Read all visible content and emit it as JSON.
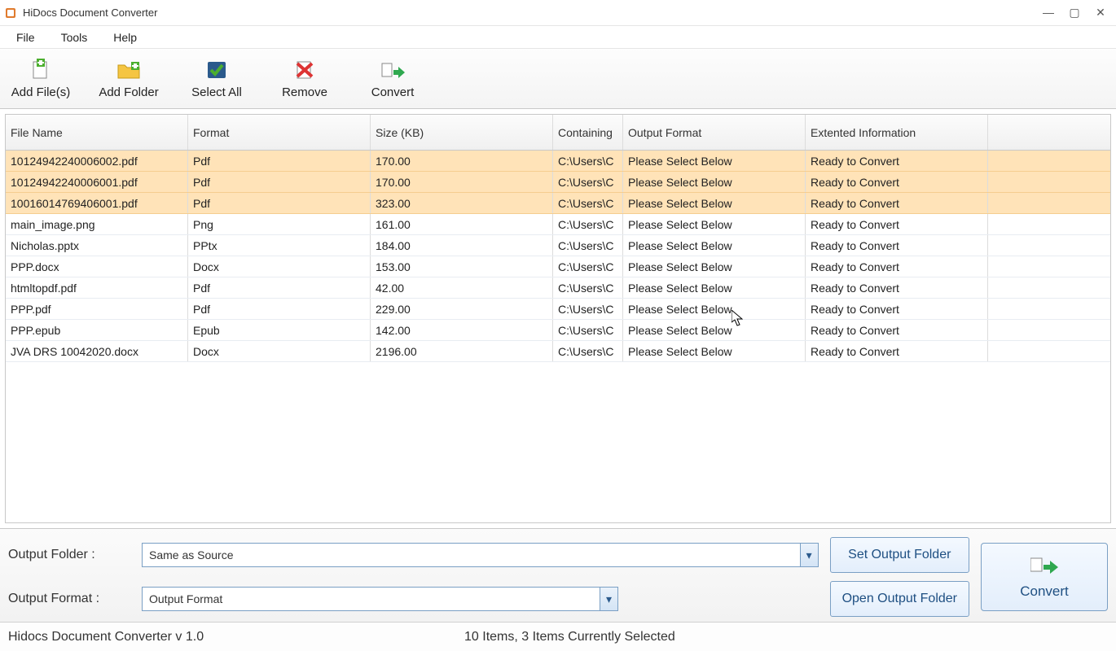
{
  "window": {
    "title": "HiDocs Document Converter"
  },
  "menu": {
    "items": [
      "File",
      "Tools",
      "Help"
    ]
  },
  "toolbar": {
    "add_files": "Add File(s)",
    "add_folder": "Add Folder",
    "select_all": "Select All",
    "remove": "Remove",
    "convert": "Convert"
  },
  "table": {
    "headers": {
      "filename": "File Name",
      "format": "Format",
      "size": "Size (KB)",
      "containing": "Containing",
      "outputfmt": "Output Format",
      "extinfo": "Extented Information"
    },
    "rows": [
      {
        "selected": true,
        "filename": "10124942240006002.pdf",
        "format": "Pdf",
        "size": "170.00",
        "containing": "C:\\Users\\C",
        "outputfmt": "Please Select Below",
        "extinfo": "Ready to Convert"
      },
      {
        "selected": true,
        "filename": "10124942240006001.pdf",
        "format": "Pdf",
        "size": "170.00",
        "containing": "C:\\Users\\C",
        "outputfmt": "Please Select Below",
        "extinfo": "Ready to Convert"
      },
      {
        "selected": true,
        "filename": "10016014769406001.pdf",
        "format": "Pdf",
        "size": "323.00",
        "containing": "C:\\Users\\C",
        "outputfmt": "Please Select Below",
        "extinfo": "Ready to Convert"
      },
      {
        "selected": false,
        "filename": "main_image.png",
        "format": "Png",
        "size": "161.00",
        "containing": "C:\\Users\\C",
        "outputfmt": "Please Select Below",
        "extinfo": "Ready to Convert"
      },
      {
        "selected": false,
        "filename": "Nicholas.pptx",
        "format": "PPtx",
        "size": "184.00",
        "containing": "C:\\Users\\C",
        "outputfmt": "Please Select Below",
        "extinfo": "Ready to Convert"
      },
      {
        "selected": false,
        "filename": "PPP.docx",
        "format": "Docx",
        "size": "153.00",
        "containing": "C:\\Users\\C",
        "outputfmt": "Please Select Below",
        "extinfo": "Ready to Convert"
      },
      {
        "selected": false,
        "filename": "htmltopdf.pdf",
        "format": "Pdf",
        "size": "42.00",
        "containing": "C:\\Users\\C",
        "outputfmt": "Please Select Below",
        "extinfo": "Ready to Convert"
      },
      {
        "selected": false,
        "filename": "PPP.pdf",
        "format": "Pdf",
        "size": "229.00",
        "containing": "C:\\Users\\C",
        "outputfmt": "Please Select Below",
        "extinfo": "Ready to Convert"
      },
      {
        "selected": false,
        "filename": "PPP.epub",
        "format": "Epub",
        "size": "142.00",
        "containing": "C:\\Users\\C",
        "outputfmt": "Please Select Below",
        "extinfo": "Ready to Convert"
      },
      {
        "selected": false,
        "filename": "JVA DRS 10042020.docx",
        "format": "Docx",
        "size": "2196.00",
        "containing": "C:\\Users\\C",
        "outputfmt": "Please Select Below",
        "extinfo": "Ready to Convert"
      }
    ]
  },
  "bottom": {
    "output_folder_label": "Output Folder :",
    "output_folder_value": "Same as Source",
    "output_format_label": "Output Format :",
    "output_format_value": "Output Format",
    "set_output_folder": "Set Output Folder",
    "open_output_folder": "Open Output Folder",
    "convert": "Convert"
  },
  "status": {
    "left": "Hidocs Document Converter v 1.0",
    "right": "10 Items, 3 Items Currently Selected"
  }
}
